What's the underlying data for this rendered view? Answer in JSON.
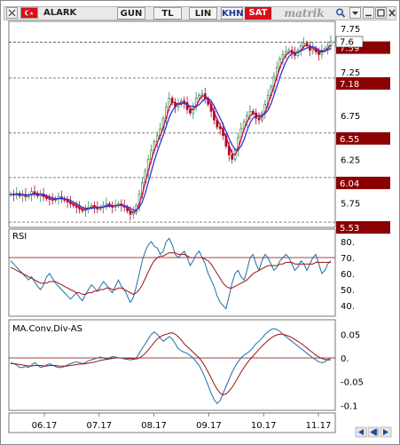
{
  "toolbar": {
    "symbol": "ALARK",
    "buttons": [
      "GUN",
      "TL",
      "LIN"
    ],
    "khn": "KHN",
    "sat": "SAT",
    "brand": "matrik"
  },
  "colors": {
    "up": "#2e8b57",
    "down": "#a0102a",
    "ma_fast": "#e0002a",
    "ma_slow": "#3030e0",
    "support": "#8b0000",
    "osc_line": "#1f6fa5",
    "osc_signal": "#a01010"
  },
  "price_panel": {
    "y_ticks": [
      "7.75",
      "7.25",
      "6.75",
      "6.25",
      "5.75"
    ],
    "last_price_label": "7.6",
    "levels": [
      {
        "label": "7.59",
        "value": 7.59
      },
      {
        "label": "7.18",
        "value": 7.18
      },
      {
        "label": "6.55",
        "value": 6.55
      },
      {
        "label": "6.04",
        "value": 6.04
      },
      {
        "label": "5.53",
        "value": 5.53
      }
    ]
  },
  "rsi_panel": {
    "title": "RSI",
    "y_ticks": [
      "80.",
      "70.",
      "60.",
      "50.",
      "40."
    ]
  },
  "macd_panel": {
    "title": "MA.Conv.Div-AS",
    "y_ticks": [
      "0.05",
      "0.",
      "-0.05",
      "-0.1"
    ]
  },
  "x_ticks": [
    "06.17",
    "07.17",
    "08.17",
    "09.17",
    "10.17",
    "11.17"
  ],
  "chart_data": [
    {
      "type": "line",
      "panel": "price",
      "x_range": [
        "06.17",
        "11.17"
      ],
      "ylim": [
        5.5,
        7.8
      ],
      "series": [
        {
          "values": [
            5.85,
            5.84,
            5.86,
            5.83,
            5.85,
            5.82,
            5.84,
            5.88,
            5.86,
            5.83,
            5.85,
            5.82,
            5.8,
            5.79,
            5.78,
            5.8,
            5.82,
            5.8,
            5.78,
            5.76,
            5.74,
            5.72,
            5.7,
            5.68,
            5.66,
            5.68,
            5.7,
            5.72,
            5.7,
            5.68,
            5.7,
            5.72,
            5.74,
            5.72,
            5.7,
            5.72,
            5.74,
            5.72,
            5.7,
            5.66,
            5.62,
            5.64,
            5.72,
            5.85,
            5.98,
            6.12,
            6.25,
            6.35,
            6.45,
            6.52,
            6.6,
            6.72,
            6.85,
            6.95,
            6.9,
            6.85,
            6.88,
            6.92,
            6.9,
            6.82,
            6.78,
            6.85,
            6.95,
            6.98,
            7.0,
            6.94,
            6.88,
            6.8,
            6.7,
            6.62,
            6.6,
            6.52,
            6.4,
            6.3,
            6.25,
            6.35,
            6.5,
            6.6,
            6.68,
            6.75,
            6.8,
            6.78,
            6.72,
            6.7,
            6.78,
            6.88,
            6.98,
            7.08,
            7.2,
            7.3,
            7.4,
            7.45,
            7.48,
            7.5,
            7.47,
            7.44,
            7.5,
            7.55,
            7.58,
            7.55,
            7.5,
            7.52,
            7.48,
            7.45,
            7.5,
            7.52,
            7.55,
            7.6
          ]
        }
      ]
    },
    {
      "type": "line",
      "panel": "rsi",
      "x_range": [
        "06.17",
        "11.17"
      ],
      "ylim": [
        35,
        85
      ],
      "series": [
        {
          "values": [
            68,
            66,
            64,
            62,
            60,
            58,
            56,
            58,
            55,
            52,
            50,
            53,
            58,
            60,
            57,
            54,
            52,
            50,
            48,
            46,
            44,
            46,
            48,
            45,
            43,
            47,
            50,
            53,
            51,
            49,
            52,
            55,
            53,
            50,
            48,
            52,
            56,
            52,
            50,
            46,
            42,
            45,
            52,
            60,
            68,
            74,
            78,
            80,
            77,
            76,
            72,
            74,
            80,
            82,
            78,
            72,
            70,
            72,
            74,
            70,
            65,
            68,
            72,
            74,
            70,
            66,
            60,
            56,
            52,
            46,
            42,
            40,
            38,
            46,
            54,
            60,
            62,
            58,
            56,
            62,
            70,
            72,
            66,
            62,
            68,
            72,
            70,
            66,
            62,
            64,
            68,
            70,
            72,
            70,
            66,
            62,
            64,
            68,
            66,
            62,
            66,
            70,
            72,
            66,
            60,
            62,
            66,
            68
          ]
        },
        {
          "values": [
            64,
            63,
            62,
            61,
            60,
            59,
            58,
            57,
            56,
            55,
            54,
            54,
            54,
            55,
            55,
            55,
            54,
            53,
            52,
            51,
            50,
            49,
            48,
            48,
            47,
            47,
            48,
            48,
            49,
            49,
            50,
            50,
            51,
            51,
            50,
            50,
            51,
            51,
            50,
            49,
            48,
            47,
            48,
            50,
            53,
            57,
            61,
            65,
            68,
            70,
            71,
            71,
            72,
            73,
            73,
            73,
            72,
            72,
            72,
            71,
            70,
            70,
            70,
            70,
            70,
            69,
            68,
            66,
            63,
            60,
            57,
            54,
            52,
            51,
            51,
            52,
            53,
            54,
            55,
            56,
            58,
            60,
            61,
            62,
            63,
            64,
            65,
            65,
            65,
            65,
            66,
            66,
            67,
            67,
            67,
            66,
            66,
            66,
            66,
            66,
            66,
            66,
            67,
            67,
            67,
            67,
            67,
            67
          ]
        }
      ]
    },
    {
      "type": "line",
      "panel": "macd",
      "x_range": [
        "06.17",
        "11.17"
      ],
      "ylim": [
        -0.105,
        0.075
      ],
      "series": [
        {
          "values": [
            -0.01,
            -0.012,
            -0.015,
            -0.02,
            -0.02,
            -0.018,
            -0.02,
            -0.015,
            -0.01,
            -0.015,
            -0.02,
            -0.018,
            -0.015,
            -0.012,
            -0.015,
            -0.018,
            -0.02,
            -0.02,
            -0.018,
            -0.015,
            -0.012,
            -0.01,
            -0.008,
            -0.01,
            -0.012,
            -0.01,
            -0.006,
            -0.004,
            -0.002,
            0.0,
            0.002,
            0.0,
            -0.002,
            0.0,
            0.003,
            0.002,
            0.0,
            0.0,
            -0.002,
            -0.003,
            -0.004,
            -0.003,
            0.0,
            0.01,
            0.02,
            0.03,
            0.04,
            0.05,
            0.055,
            0.05,
            0.042,
            0.035,
            0.04,
            0.045,
            0.04,
            0.03,
            0.02,
            0.015,
            0.012,
            0.01,
            0.005,
            0.0,
            -0.008,
            -0.016,
            -0.028,
            -0.042,
            -0.058,
            -0.074,
            -0.088,
            -0.096,
            -0.09,
            -0.075,
            -0.06,
            -0.045,
            -0.03,
            -0.018,
            -0.008,
            0.0,
            0.006,
            0.01,
            0.015,
            0.022,
            0.03,
            0.035,
            0.042,
            0.05,
            0.055,
            0.06,
            0.062,
            0.06,
            0.056,
            0.05,
            0.045,
            0.04,
            0.035,
            0.03,
            0.025,
            0.02,
            0.015,
            0.01,
            0.005,
            0.0,
            -0.004,
            -0.008,
            -0.01,
            -0.008,
            -0.003,
            0.0
          ]
        },
        {
          "values": [
            -0.012,
            -0.012,
            -0.013,
            -0.014,
            -0.015,
            -0.016,
            -0.017,
            -0.017,
            -0.016,
            -0.016,
            -0.016,
            -0.017,
            -0.017,
            -0.016,
            -0.016,
            -0.016,
            -0.017,
            -0.017,
            -0.017,
            -0.017,
            -0.016,
            -0.015,
            -0.014,
            -0.013,
            -0.013,
            -0.012,
            -0.011,
            -0.01,
            -0.009,
            -0.007,
            -0.005,
            -0.004,
            -0.003,
            -0.002,
            -0.001,
            0.0,
            0.0,
            0.0,
            0.0,
            -0.001,
            -0.001,
            -0.002,
            -0.002,
            0.0,
            0.004,
            0.01,
            0.017,
            0.025,
            0.033,
            0.04,
            0.045,
            0.048,
            0.05,
            0.052,
            0.053,
            0.05,
            0.045,
            0.038,
            0.03,
            0.024,
            0.018,
            0.012,
            0.006,
            0.0,
            -0.008,
            -0.018,
            -0.03,
            -0.042,
            -0.055,
            -0.066,
            -0.074,
            -0.078,
            -0.076,
            -0.07,
            -0.062,
            -0.052,
            -0.041,
            -0.03,
            -0.02,
            -0.011,
            -0.003,
            0.004,
            0.011,
            0.018,
            0.025,
            0.031,
            0.037,
            0.042,
            0.046,
            0.049,
            0.05,
            0.05,
            0.048,
            0.046,
            0.043,
            0.039,
            0.035,
            0.031,
            0.026,
            0.021,
            0.016,
            0.011,
            0.006,
            0.002,
            -0.001,
            -0.003,
            -0.004,
            -0.004
          ]
        }
      ]
    }
  ]
}
